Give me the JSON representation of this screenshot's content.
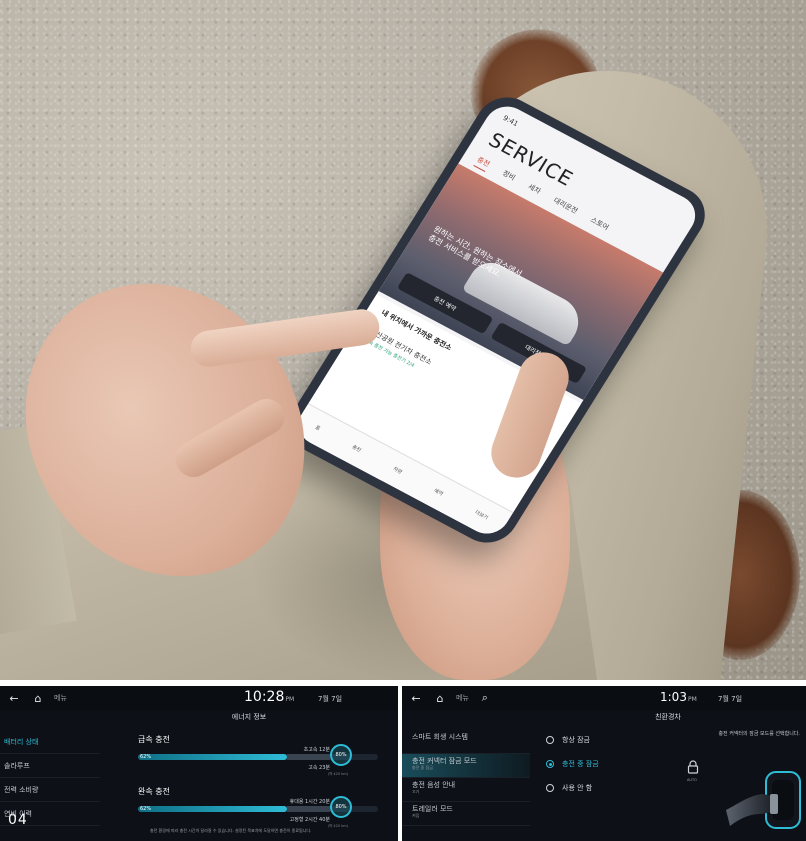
{
  "photo": {
    "phone_screen": {
      "status_time": "9:41",
      "title": "SERVICE",
      "tabs": [
        "충전",
        "정비",
        "세차",
        "대리운전",
        "스토어"
      ],
      "active_tab": "충전",
      "hero_text_line1": "원하는 시간, 원하는 장소에서",
      "hero_text_line2": "충전 서비스를 받으세요.",
      "buttons": [
        "충전 예약",
        "대리점 방문"
      ],
      "card_title": "내 위치에서 가까운 충전소",
      "card_sub": "도산공원 전기차 충전소",
      "card_green": "급속 충전 가능 충전기 2/4",
      "nav": [
        "홈",
        "충전",
        "차량",
        "예약",
        "더보기"
      ]
    }
  },
  "energy_panel": {
    "back_icon": "back-arrow-icon",
    "home_icon": "home-icon",
    "menu_label": "메뉴",
    "time": "10:28",
    "ampm": "PM",
    "date": "7월 7일",
    "title": "에너지 정보",
    "sidebar": [
      "배터리 상태",
      "솔라루프",
      "전력 소비량",
      "연비 이력"
    ],
    "active_sidebar": "배터리 상태",
    "fast": {
      "title": "급속 충전",
      "top_right": "초고속 12분",
      "current_pct": "62%",
      "current_fraction": 0.62,
      "target_pct": "80%",
      "target_fraction": 0.8,
      "bottom_right": "고속 23분",
      "tiny": "(약 420 km)"
    },
    "slow": {
      "title": "완속 충전",
      "top_right": "휴대용 1시간 20분",
      "current_pct": "62%",
      "current_fraction": 0.62,
      "target_pct": "80%",
      "target_fraction": 0.8,
      "bottom_right": "고정형 2시간 40분",
      "tiny": "(약 420 km)"
    },
    "note": "충전 환경에 따라 충전 시간이 달라질 수 있습니다. 설정된 목표치에 도달하면 충전이 종료됩니다.",
    "page_number": "04"
  },
  "ev_panel": {
    "back_icon": "back-arrow-icon",
    "home_icon": "home-icon",
    "menu_label": "메뉴",
    "search_icon": "search-icon",
    "time": "1:03",
    "ampm": "PM",
    "date": "7월 7일",
    "title": "친환경차",
    "sidebar": [
      {
        "label": "스마트 회생 시스템",
        "sub": ""
      },
      {
        "label": "충전 커넥터 잠금 모드",
        "sub": "충전 중 잠금"
      },
      {
        "label": "충전 음성 안내",
        "sub": "끄기"
      },
      {
        "label": "트레일러 모드",
        "sub": "켜짐"
      }
    ],
    "active_sidebar": "충전 커넥터 잠금 모드",
    "options": [
      "항상 잠금",
      "충전 중 잠금",
      "사용 안 함"
    ],
    "selected_option": "충전 중 잠금",
    "hint": "충전 커넥터의 잠금 모드를 선택합니다.",
    "lock_caption": "AUTO",
    "accent_color": "#2fbcd6"
  }
}
